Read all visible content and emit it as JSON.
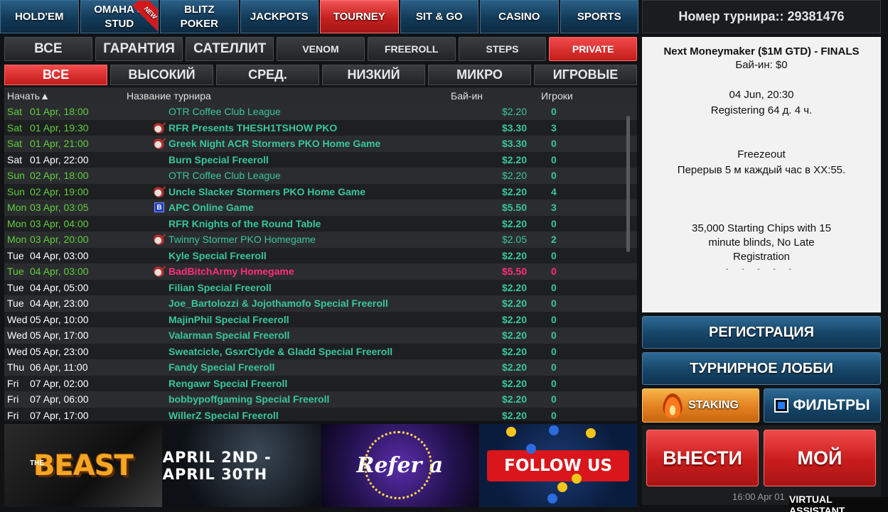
{
  "top_tabs": [
    {
      "label": "HOLD'EM"
    },
    {
      "label": "OMAHA & STUD",
      "badge": "NEW"
    },
    {
      "label": "BLITZ POKER"
    },
    {
      "label": "JACKPOTS"
    },
    {
      "label": "TOURNEY",
      "active": true
    },
    {
      "label": "SIT & GO"
    },
    {
      "label": "CASINO"
    },
    {
      "label": "SPORTS"
    }
  ],
  "type_filters": [
    "ВСЕ",
    "ГАРАНТИЯ",
    "САТЕЛЛИТ",
    "VENOM",
    "FREEROLL",
    "STEPS",
    "PRIVATE"
  ],
  "stake_filters": [
    "ВСЕ",
    "ВЫСОКИЙ",
    "СРЕД.",
    "НИЗКИЙ",
    "МИКРО",
    "ИГРОВЫЕ"
  ],
  "table": {
    "headers": {
      "start": "Начать▲",
      "name": "Название турнира",
      "buyin": "Бай-ин",
      "players": "Игроки"
    },
    "rows": [
      {
        "day": "Sat",
        "date": "01 Apr, 18:00",
        "icon": "",
        "name": "OTR Coffee Club League",
        "buyin": "$2.20",
        "players": "0",
        "start_color": "green",
        "plain": true
      },
      {
        "day": "Sat",
        "date": "01 Apr, 19:30",
        "icon": "guitar",
        "name": "RFR Presents THESH1TSHOW PKO",
        "buyin": "$3.30",
        "players": "3",
        "start_color": "green"
      },
      {
        "day": "Sat",
        "date": "01 Apr, 21:00",
        "icon": "guitar",
        "name": "Greek Night ACR Stormers PKO Home Game",
        "buyin": "$3.30",
        "players": "0",
        "start_color": "green"
      },
      {
        "day": "Sat",
        "date": "01 Apr, 22:00",
        "icon": "",
        "name": "Burn Special Freeroll",
        "buyin": "$2.20",
        "players": "0",
        "start_color": "white"
      },
      {
        "day": "Sun",
        "date": "02 Apr, 18:00",
        "icon": "",
        "name": "OTR Coffee Club League",
        "buyin": "$2.20",
        "players": "0",
        "start_color": "green",
        "plain": true
      },
      {
        "day": "Sun",
        "date": "02 Apr, 19:00",
        "icon": "guitar",
        "name": "Uncle Slacker Stormers PKO Home Game",
        "buyin": "$2.20",
        "players": "4",
        "start_color": "green"
      },
      {
        "day": "Mon",
        "date": "03 Apr, 03:05",
        "icon": "b",
        "name": "APC Online Game",
        "buyin": "$5.50",
        "players": "3",
        "start_color": "green"
      },
      {
        "day": "Mon",
        "date": "03 Apr, 04:00",
        "icon": "",
        "name": "RFR Knights of the Round Table",
        "buyin": "$2.20",
        "players": "0",
        "start_color": "green"
      },
      {
        "day": "Mon",
        "date": "03 Apr, 20:00",
        "icon": "guitar",
        "name": "Twinny Stormer PKO Homegame",
        "buyin": "$2.05",
        "players": "2",
        "start_color": "green",
        "plain": true
      },
      {
        "day": "Tue",
        "date": "04 Apr, 03:00",
        "icon": "",
        "name": "Kyle Special Freeroll",
        "buyin": "$2.20",
        "players": "0",
        "start_color": "white"
      },
      {
        "day": "Tue",
        "date": "04 Apr, 03:00",
        "icon": "guitar",
        "name": "BadBitchArmy Homegame",
        "buyin": "$5.50",
        "players": "0",
        "start_color": "green",
        "pink": true
      },
      {
        "day": "Tue",
        "date": "04 Apr, 05:00",
        "icon": "",
        "name": "Filian Special Freeroll",
        "buyin": "$2.20",
        "players": "0",
        "start_color": "white"
      },
      {
        "day": "Tue",
        "date": "04 Apr, 23:00",
        "icon": "",
        "name": "Joe_Bartolozzi & Jojothamofo Special Freeroll",
        "buyin": "$2.20",
        "players": "0",
        "start_color": "white"
      },
      {
        "day": "Wed",
        "date": "05 Apr, 10:00",
        "icon": "",
        "name": "MajinPhil Special Freeroll",
        "buyin": "$2.20",
        "players": "0",
        "start_color": "white"
      },
      {
        "day": "Wed",
        "date": "05 Apr, 17:00",
        "icon": "",
        "name": "Valarman Special Freeroll",
        "buyin": "$2.20",
        "players": "0",
        "start_color": "white"
      },
      {
        "day": "Wed",
        "date": "05 Apr, 23:00",
        "icon": "",
        "name": "Sweatcicle, GsxrClyde & Gladd Special Freeroll",
        "buyin": "$2.20",
        "players": "0",
        "start_color": "white"
      },
      {
        "day": "Thu",
        "date": "06 Apr, 11:00",
        "icon": "",
        "name": "Fandy Special Freeroll",
        "buyin": "$2.20",
        "players": "0",
        "start_color": "white"
      },
      {
        "day": "Fri",
        "date": "07 Apr, 02:00",
        "icon": "",
        "name": "Rengawr Special Freeroll",
        "buyin": "$2.20",
        "players": "0",
        "start_color": "white"
      },
      {
        "day": "Fri",
        "date": "07 Apr, 06:00",
        "icon": "",
        "name": "bobbypoffgaming Special Freeroll",
        "buyin": "$2.20",
        "players": "0",
        "start_color": "white"
      },
      {
        "day": "Fri",
        "date": "07 Apr, 17:00",
        "icon": "",
        "name": "WillerZ Special Freeroll",
        "buyin": "$2.20",
        "players": "0",
        "start_color": "white"
      }
    ]
  },
  "banners": {
    "beast": {
      "the": "THE",
      "main": "BEAST"
    },
    "dates": "APRIL 2ND - APRIL 30TH",
    "refer": "Refer a",
    "follow": "FOLLOW US"
  },
  "right_panel": {
    "tourney_number": "Номер турнира:: 29381476",
    "title": "Next Moneymaker ($1M GTD) - FINALS",
    "buyin": "Бай-ин: $0",
    "date": "04 Jun, 20:30",
    "status": "Registering   64 д. 4 ч.",
    "format": "Freezeout",
    "break": "Перерыв 5 м каждый час в XX:55.",
    "description": "35,000 Starting Chips with 15 minute blinds, No Late Registration",
    "dashes": "-   -   -   -   -"
  },
  "buttons": {
    "register": "РЕГИСТРАЦИЯ",
    "lobby": "ТУРНИРНОЕ ЛОББИ",
    "staking": "STAKING",
    "filters": "ФИЛЬТРЫ",
    "deposit": "ВНЕСТИ",
    "my": "МОЙ"
  },
  "clock": "16:00 Apr 01",
  "virtual_assistant": "VIRTUAL ASSISTANT",
  "colors": {
    "active_tab": "#c51f1f",
    "blue_button": "#154566",
    "green_text": "#38c79b",
    "pink_text": "#ff2d7a",
    "start_green": "#5fcf3c"
  }
}
